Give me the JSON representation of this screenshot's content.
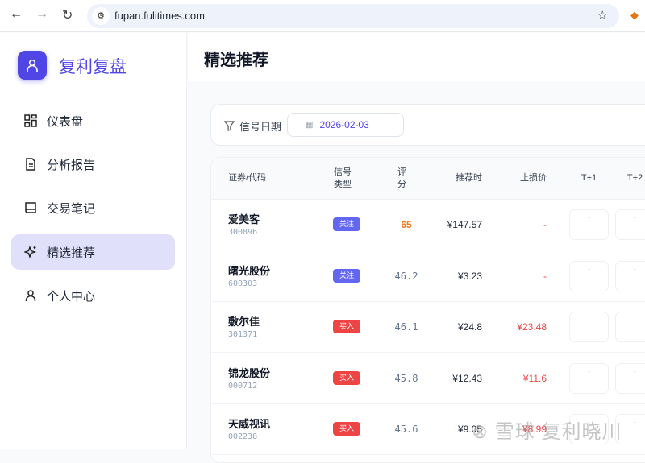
{
  "browser": {
    "url": "fupan.fulitimes.com"
  },
  "sidebar": {
    "brand": "复利复盘",
    "items": [
      {
        "label": "仪表盘"
      },
      {
        "label": "分析报告"
      },
      {
        "label": "交易笔记"
      },
      {
        "label": "精选推荐"
      },
      {
        "label": "个人中心"
      }
    ]
  },
  "header": {
    "title": "精选推荐"
  },
  "filter": {
    "label": "信号日期",
    "date": "2026-02-03"
  },
  "table": {
    "columns": {
      "stock": "证券/代码",
      "type1": "信号",
      "type2": "类型",
      "score1": "评",
      "score2": "分",
      "price": "推荐时",
      "stop": "止损价",
      "t1": "T+1",
      "t2": "T+2"
    },
    "rows": [
      {
        "name": "爱美客",
        "code": "300896",
        "type": "关注",
        "score": "65",
        "price": "¥147.57",
        "stop": "-",
        "t1": "-",
        "t2": "-"
      },
      {
        "name": "曙光股份",
        "code": "600303",
        "type": "关注",
        "score": "46.2",
        "price": "¥3.23",
        "stop": "-",
        "t1": "-",
        "t2": "-"
      },
      {
        "name": "敷尔佳",
        "code": "301371",
        "type": "买入",
        "score": "46.1",
        "price": "¥24.8",
        "stop": "¥23.48",
        "t1": "-",
        "t2": "-"
      },
      {
        "name": "锦龙股份",
        "code": "000712",
        "type": "买入",
        "score": "45.8",
        "price": "¥12.43",
        "stop": "¥11.6",
        "t1": "-",
        "t2": "-"
      },
      {
        "name": "天威视讯",
        "code": "002238",
        "type": "买入",
        "score": "45.6",
        "price": "¥9.05",
        "stop": "¥8.99",
        "t1": "-",
        "t2": "-"
      }
    ]
  },
  "watermark": "雪球 复利晓川",
  "colors": {
    "accent": "#4f46e5",
    "watch": "#6366f1",
    "buy": "#ef4444",
    "highscore": "#f97316"
  }
}
